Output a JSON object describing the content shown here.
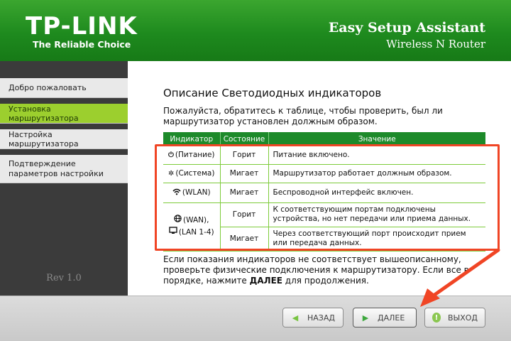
{
  "header": {
    "logo": "TP-LINK",
    "tagline": "The Reliable Choice",
    "app_title": "Easy Setup Assistant",
    "app_subtitle": "Wireless N Router"
  },
  "sidebar": {
    "items": [
      {
        "label": "Добро пожаловать",
        "active": false
      },
      {
        "label": "Установка маршрутизатора",
        "active": true
      },
      {
        "label": "Настройка маршрутизатора",
        "active": false
      },
      {
        "label": "Подтверждение параметров настройки",
        "active": false
      }
    ],
    "version": "Rev 1.0"
  },
  "main": {
    "title": "Описание Светодиодных индикаторов",
    "intro": "Пожалуйста, обратитесь к таблице, чтобы проверить, был ли маршрутизатор установлен должным образом.",
    "table": {
      "headers": [
        "Индикатор",
        "Состояние",
        "Значение"
      ],
      "rows": [
        {
          "icon": "power-icon",
          "indicator": "(Питание)",
          "state": "Горит",
          "meaning": "Питание включено."
        },
        {
          "icon": "system-gear-icon",
          "indicator": "(Система)",
          "state": "Мигает",
          "meaning": "Маршрутизатор работает должным образом."
        },
        {
          "icon": "wlan-icon",
          "indicator": "(WLAN)",
          "state": "Мигает",
          "meaning": "Беспроводной интерфейс включен."
        }
      ],
      "wan_lan": {
        "wan_label": "(WAN),",
        "lan_label": "(LAN 1-4)",
        "rows": [
          {
            "state": "Горит",
            "meaning": "К соответствующим портам подключены устройства, но нет передачи или приема данных."
          },
          {
            "state": "Мигает",
            "meaning": "Через соответствующий порт происходит прием или передача данных."
          }
        ]
      }
    },
    "outro_prefix": "Если показания индикаторов не соответствует вышеописанному, проверьте физические подключения к маршрутизатору. Если все в порядке, нажмите ",
    "outro_bold": "ДАЛЕЕ",
    "outro_suffix": " для продолжения."
  },
  "footer": {
    "back_label": "НАЗАД",
    "next_label": "ДАЛЕЕ",
    "exit_label": "ВЫХОД"
  },
  "colors": {
    "header_green": "#1e8a1e",
    "active_item": "#9ccf2e",
    "table_header": "#1d8a2a",
    "highlight": "#f04525"
  }
}
